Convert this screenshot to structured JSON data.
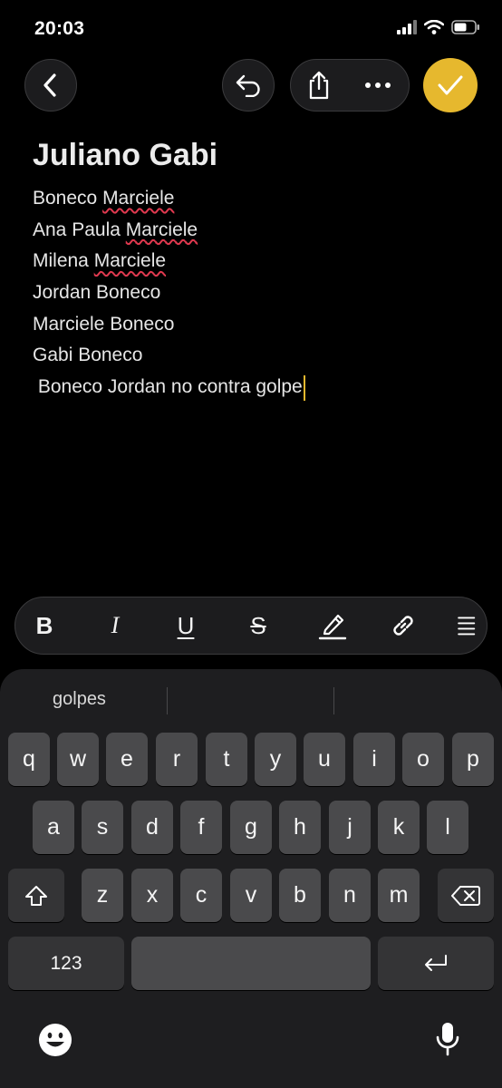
{
  "status": {
    "time": "20:03"
  },
  "toolbar": {
    "back_icon": "chevron-left-icon",
    "undo_icon": "undo-icon",
    "share_icon": "share-icon",
    "more_icon": "ellipsis-icon",
    "done_icon": "checkmark-icon",
    "accent": "#e6b82e"
  },
  "note": {
    "title": "Juliano Gabi",
    "lines": [
      {
        "a": "Boneco ",
        "b": "Marciele"
      },
      {
        "a": "Ana Paula ",
        "b": "Marciele"
      },
      {
        "a": "Milena ",
        "b": "Marciele"
      },
      {
        "a": "Jordan Boneco",
        "b": ""
      },
      {
        "a": "Marciele Boneco",
        "b": ""
      },
      {
        "a": "Gabi Boneco",
        "b": ""
      },
      {
        "a": " Boneco Jordan no contra golpe",
        "b": ""
      }
    ]
  },
  "format_bar": {
    "bold": "B",
    "italic": "I",
    "underline": "U",
    "strikethrough": "S"
  },
  "keyboard": {
    "suggestions": [
      "golpes",
      "",
      ""
    ],
    "row1": [
      "q",
      "w",
      "e",
      "r",
      "t",
      "y",
      "u",
      "i",
      "o",
      "p"
    ],
    "row2": [
      "a",
      "s",
      "d",
      "f",
      "g",
      "h",
      "j",
      "k",
      "l"
    ],
    "row3": [
      "z",
      "x",
      "c",
      "v",
      "b",
      "n",
      "m"
    ],
    "numbers_key": "123"
  }
}
